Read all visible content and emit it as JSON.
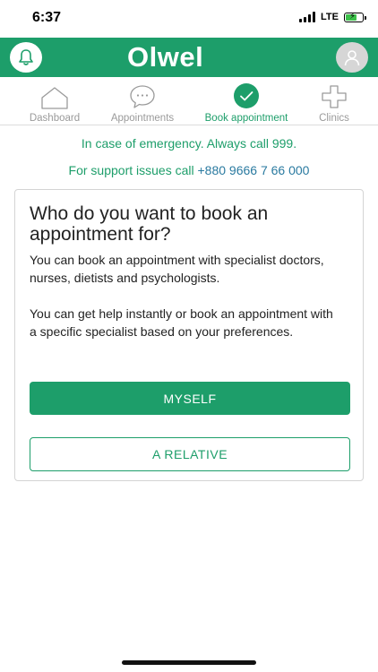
{
  "status_bar": {
    "time": "6:37",
    "network": "LTE",
    "battery_level": 0.7
  },
  "header": {
    "logo_text": "Olwel",
    "bell_icon": "bell-icon",
    "profile_icon": "user-icon",
    "brand_color": "#1d9e6a"
  },
  "tabs": [
    {
      "label": "Dashboard",
      "icon": "house-icon",
      "active": false
    },
    {
      "label": "Appointments",
      "icon": "chat-bubble-icon",
      "active": false
    },
    {
      "label": "Book appointment",
      "icon": "check-circle-icon",
      "active": true
    },
    {
      "label": "Clinics",
      "icon": "medical-cross-icon",
      "active": false
    }
  ],
  "notices": {
    "emergency": "In case of emergency. Always call 999.",
    "support_prefix": "For support issues call",
    "support_phone": "+880 9666 7 66 000"
  },
  "card": {
    "title": "Who do you want to book an appointment for?",
    "paragraph1": "You can book an appointment with specialist doctors, nurses, dietists and psychologists.",
    "paragraph2": "You can get help instantly or book an appointment with a specific specialist based on your preferences.",
    "myself_button": "MYSELF",
    "relative_button": "A RELATIVE"
  }
}
